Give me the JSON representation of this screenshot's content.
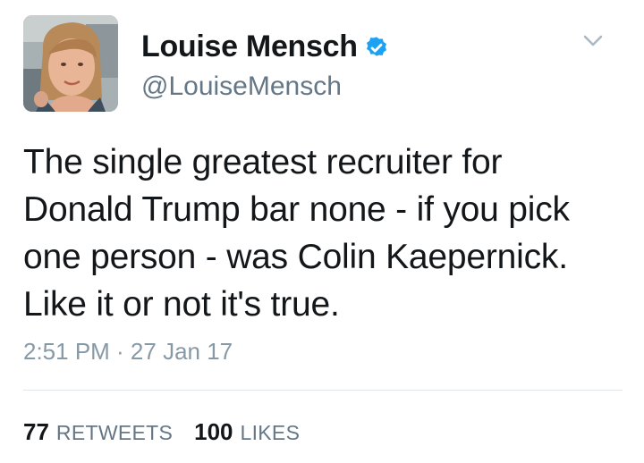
{
  "tweet": {
    "author": {
      "display_name": "Louise Mensch",
      "handle": "@LouiseMensch",
      "verified": true,
      "avatar_icon": "profile-photo"
    },
    "text_lines": [
      "The single greatest recruiter for",
      "Donald Trump bar none - if you pick",
      "one person - was Colin Kaepernick.",
      "Like it or not it's true."
    ],
    "timestamp": "2:51 PM · 27 Jan 17",
    "stats": {
      "retweets_count": "77",
      "retweets_label": "RETWEETS",
      "likes_count": "100",
      "likes_label": "LIKES"
    },
    "menu_icon": "chevron-down-icon"
  },
  "colors": {
    "verified_badge": "#1da1f2",
    "secondary_text": "#657786",
    "timestamp_text": "#8899a6",
    "divider": "#e1e8ed"
  }
}
